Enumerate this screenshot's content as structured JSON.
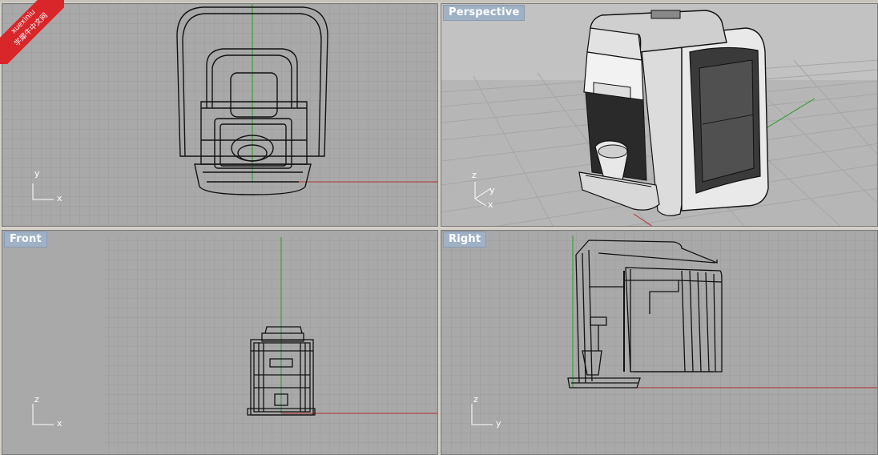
{
  "viewports": {
    "top": {
      "title": "",
      "axis": {
        "a": "y",
        "b": "x"
      }
    },
    "perspective": {
      "title": "Perspective",
      "axis": {
        "a": "z",
        "b": "y",
        "c": "x"
      }
    },
    "front": {
      "title": "Front",
      "axis": {
        "a": "z",
        "b": "x"
      }
    },
    "right": {
      "title": "Right",
      "axis": {
        "a": "z",
        "b": "y"
      }
    }
  },
  "watermark": {
    "line1": "xuexiniu",
    "line2": "学犀牛中文网"
  },
  "colors": {
    "viewport_bg": "#a9a9a9",
    "grid": "#9a9a9a",
    "grid_major": "#8e8e8e",
    "x_axis": "#b03030",
    "y_axis": "#2a9a2a",
    "title_bg": "#9fb1c5"
  }
}
